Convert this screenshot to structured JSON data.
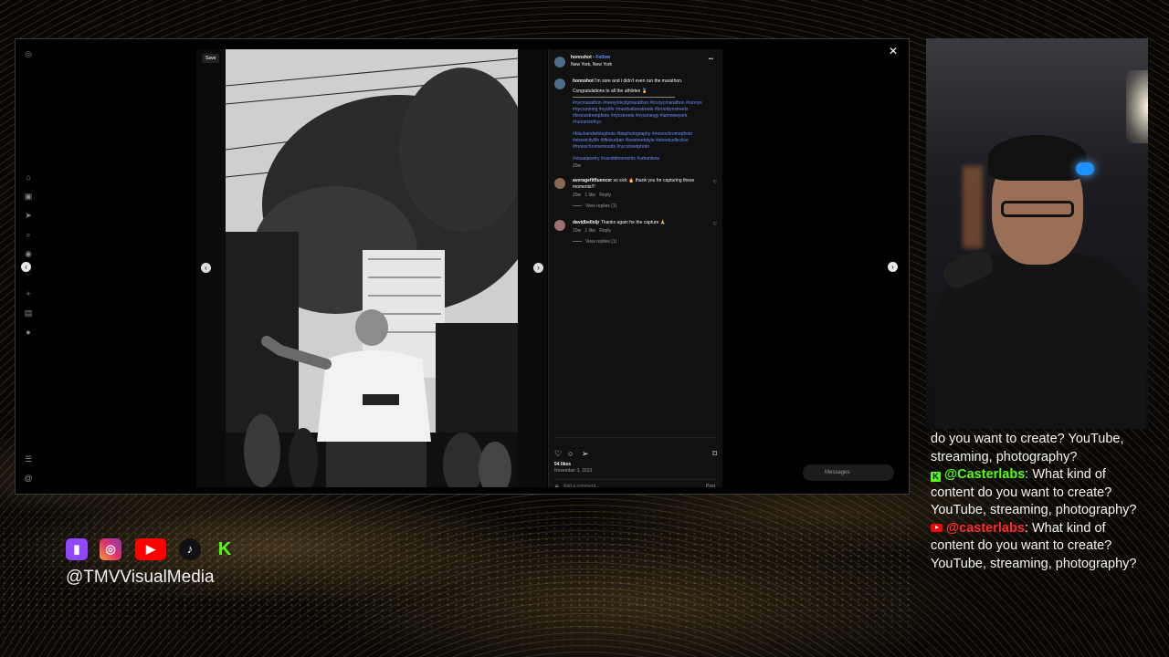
{
  "instagram": {
    "username": "honnshot",
    "follow_label": "Follow",
    "location": "New York, New York",
    "more_label": "•••",
    "save_label": "Save",
    "caption_line1": "I'm sore and i didn't even run the marathon.",
    "caption_line2": "Congratulations to all the athletes 🏅",
    "hashtags1": "#nycmarathon #newyorkcitymarathon #tcsnycmarathon #runnys #nycrunning #nyclife #manhattanstreets #brooklynstreets #bronxstreetphoto #nycstreets #nycenergy #iamnewyork #runnersofnyc",
    "hashtags2": "#blackandwhitephoto #bwphotography #monochromephoto #streetcitylife #lifeisurban #bwstreetstyle #streetcollective #monochromemoods #nycstreetphoto",
    "hashtags3": "#visualpoetry #candidmoments #urbanlens",
    "caption_time": "20w",
    "comments": [
      {
        "user": "averagefitfluencer",
        "text": "so sick 🔥 thank you for capturing these moments!!!",
        "time": "20w",
        "likes": "1 like",
        "reply": "Reply",
        "view_replies": "View replies (1)"
      },
      {
        "user": "davidbelloljr",
        "text": "Thanks again for the capture 🙏",
        "time": "20w",
        "likes": "1 like",
        "reply": "Reply",
        "view_replies": "View replies (1)"
      }
    ],
    "likes_count": "54 likes",
    "post_date": "November 3, 2023",
    "add_comment_placeholder": "Add a comment...",
    "post_label": "Post",
    "messages_label": "Messages"
  },
  "chat": {
    "line0_text": "do you want to create? YouTube, streaming, photography?",
    "line1_user": "@Casterlabs",
    "line1_text": ": What kind of content do you want to create? YouTube, streaming, photography?",
    "line2_user": "@casterlabs",
    "line2_text": ": What kind of content do you want to create? YouTube, streaming, photography?"
  },
  "overlay": {
    "handle": "@TMVVisualMedia",
    "socials": [
      "twitch-icon",
      "instagram-icon",
      "youtube-icon",
      "tiktok-icon",
      "kick-icon"
    ]
  },
  "colors": {
    "kick_green": "#53fc18",
    "youtube_red": "#ff2a2a",
    "ig_link": "#6b8cff"
  }
}
